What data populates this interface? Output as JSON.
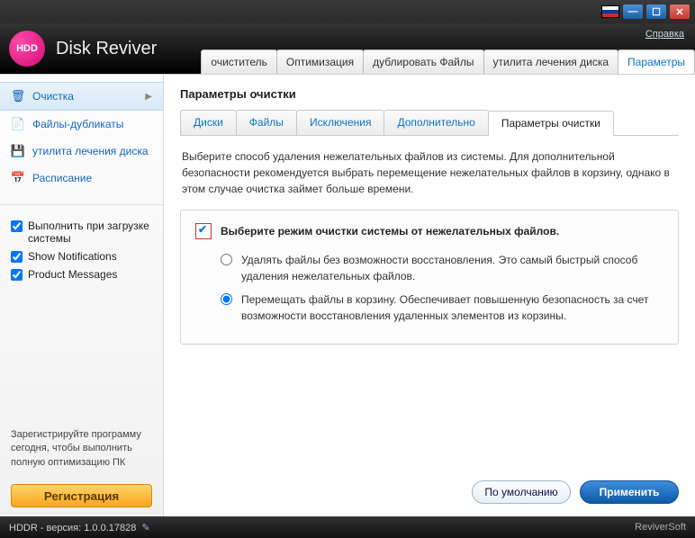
{
  "window": {
    "app_title": "Disk Reviver",
    "logo_text": "HDD",
    "help_label": "Справка"
  },
  "topnav": {
    "tabs": [
      "очиститель",
      "Оптимизация",
      "дублировать Файлы",
      "утилита лечения диска",
      "Параметры"
    ],
    "active": 4
  },
  "sidebar": {
    "items": [
      {
        "label": "Очистка",
        "icon": "🗑"
      },
      {
        "label": "Файлы-дубликаты",
        "icon": "📄"
      },
      {
        "label": "утилита лечения диска",
        "icon": "💾"
      },
      {
        "label": "Расписание",
        "icon": "📅"
      }
    ],
    "active": 0,
    "checks": [
      {
        "label": "Выполнить при загрузке системы",
        "checked": true
      },
      {
        "label": "Show Notifications",
        "checked": true
      },
      {
        "label": "Product Messages",
        "checked": true
      }
    ],
    "promo": "Зарегистрируйте программу сегодня, чтобы выполнить полную оптимизацию ПК",
    "register_label": "Регистрация"
  },
  "main": {
    "title": "Параметры очистки",
    "subtabs": [
      "Диски",
      "Файлы",
      "Исключения",
      "Дополнительно",
      "Параметры очистки"
    ],
    "subtab_active": 4,
    "description": "Выберите способ удаления нежелательных файлов из системы. Для дополнительной безопасности рекомендуется выбрать перемещение нежелательных файлов в корзину, однако в этом случае очистка займет больше времени.",
    "panel_title": "Выберите режим очистки системы от нежелательных файлов.",
    "options": [
      {
        "label": "Удалять файлы без возможности восстановления. Это самый быстрый способ удаления нежелательных файлов.",
        "selected": false
      },
      {
        "label": "Перемещать файлы в корзину. Обеспечивает повышенную безопасность за счет возможности восстановления удаленных элементов из корзины.",
        "selected": true
      }
    ],
    "default_label": "По умолчанию",
    "apply_label": "Применить"
  },
  "status": {
    "version_prefix": "HDDR - версия: ",
    "version": "1.0.0.17828",
    "brand": "ReviverSoft"
  }
}
